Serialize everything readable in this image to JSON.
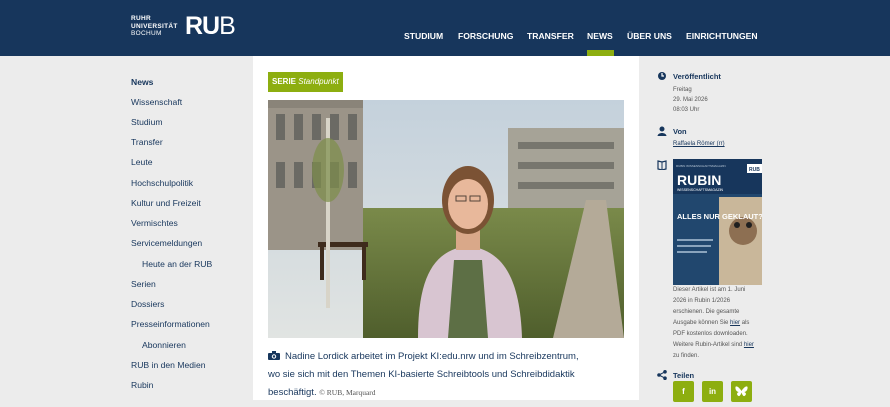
{
  "header": {
    "logo_lines": [
      "RUHR",
      "UNIVERSITÄT",
      "BOCHUM"
    ],
    "logo_ru": "RU",
    "logo_b": "B",
    "nav": [
      "STUDIUM",
      "FORSCHUNG",
      "TRANSFER",
      "NEWS",
      "ÜBER UNS",
      "EINRICHTUNGEN"
    ],
    "active_nav": "NEWS"
  },
  "sidebar": {
    "items": [
      {
        "label": "News"
      },
      {
        "label": "Wissenschaft"
      },
      {
        "label": "Studium"
      },
      {
        "label": "Transfer"
      },
      {
        "label": "Leute"
      },
      {
        "label": "Hochschulpolitik"
      },
      {
        "label": "Kultur und Freizeit"
      },
      {
        "label": "Vermischtes"
      },
      {
        "label": "Servicemeldungen"
      },
      {
        "label": "Heute an der RUB"
      },
      {
        "label": "Serien"
      },
      {
        "label": "Dossiers"
      },
      {
        "label": "Presseinformationen"
      },
      {
        "label": "Abonnieren"
      },
      {
        "label": "RUB in den Medien"
      },
      {
        "label": "Rubin"
      }
    ]
  },
  "article": {
    "series_label": "SERIE",
    "series_name": "Standpunkt",
    "caption_line1": "Nadine Lordick arbeitet im Projekt KI:edu.nrw und im Schreibzentrum,",
    "caption_line2": "wo sie sich mit den Themen KI-basierte Schreibtools und Schreibdidaktik",
    "caption_line3": "beschäftigt.",
    "credit": "© RUB, Marquard"
  },
  "info": {
    "published_heading": "Veröffentlicht",
    "published_day": "Freitag",
    "published_date": "29. Mai 2026",
    "published_time": "08:03 Uhr",
    "author_heading": "Von",
    "author_name": "Raffaela Römer (rr)",
    "cover_top": "RUBIN WISSENSCHAFTSMAGAZIN",
    "cover_rub": "RUB",
    "cover_title": "RUBIN",
    "cover_subtitle": "WISSENSCHAFTSMAGAZIN",
    "cover_headline": "ALLES NUR GEKLAUT?",
    "rubin_text_1": "Dieser Artikel ist am 1. Juni",
    "rubin_text_2": "2026 in Rubin 1/2026",
    "rubin_text_3": "erschienen. Die gesamte",
    "rubin_text_4a": "Ausgabe können Sie ",
    "rubin_link_1": "hier",
    "rubin_text_4b": " als",
    "rubin_text_5": "PDF kostenlos downloaden.",
    "rubin_text_6a": "Weitere Rubin-Artikel sind ",
    "rubin_link_2": "hier",
    "rubin_text_7": "zu finden.",
    "share_heading": "Teilen",
    "share_buttons": [
      "f",
      "in",
      "bluesky"
    ]
  },
  "colors": {
    "brand_blue": "#17365c",
    "accent_green": "#8dae10",
    "background": "#ececec"
  }
}
